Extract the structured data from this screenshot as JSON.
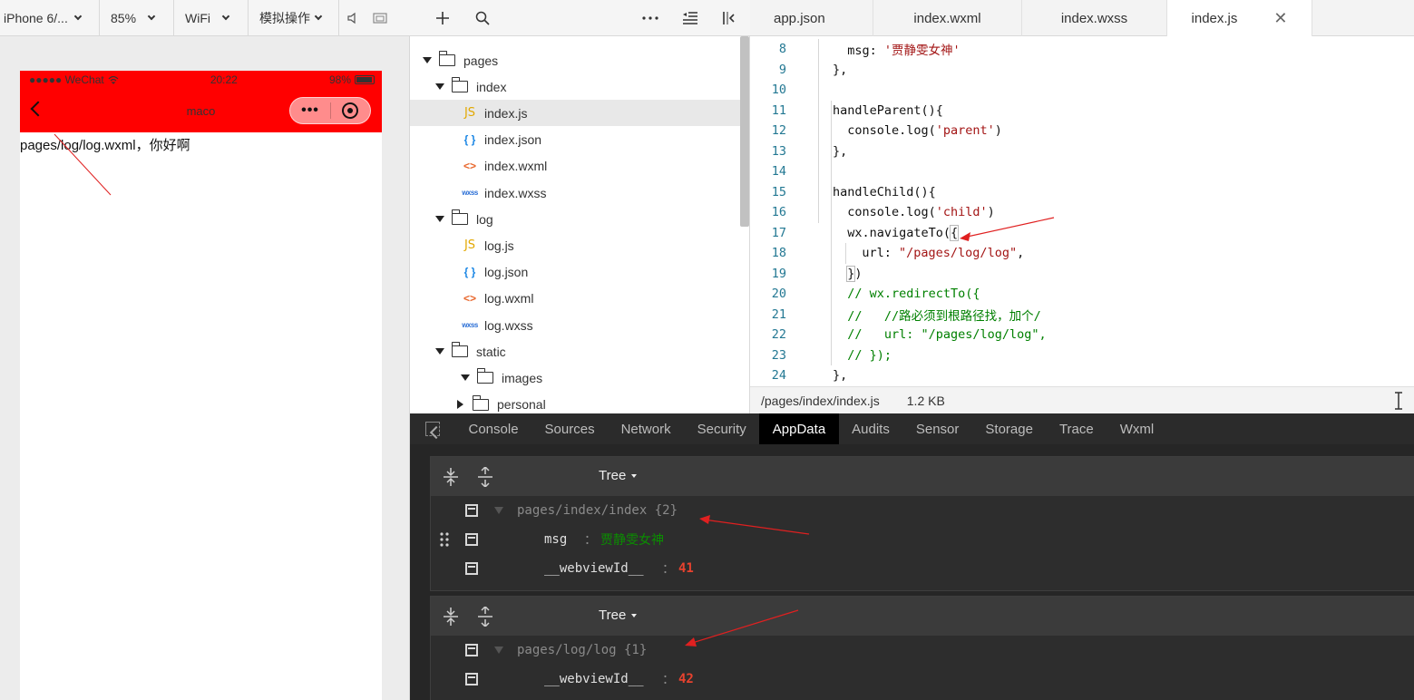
{
  "sim_toolbar": {
    "device": "iPhone 6/...",
    "zoom": "85%",
    "network": "WiFi",
    "mode": "模拟操作"
  },
  "phone": {
    "carrier": "●●●●● WeChat",
    "time": "20:22",
    "battery_pct": "98%",
    "nav_title": "maco",
    "capsule_dots": "•••",
    "page_text": "pages/log/log.wxml，你好啊"
  },
  "file_tree": [
    {
      "label": "pages",
      "type": "folder-open",
      "depth": 0
    },
    {
      "label": "index",
      "type": "folder-open",
      "depth": 1
    },
    {
      "label": "index.js",
      "type": "js",
      "depth": 2,
      "selected": true
    },
    {
      "label": "index.json",
      "type": "json",
      "depth": 2
    },
    {
      "label": "index.wxml",
      "type": "wxml",
      "depth": 2
    },
    {
      "label": "index.wxss",
      "type": "wxss",
      "depth": 2
    },
    {
      "label": "log",
      "type": "folder-open",
      "depth": 1
    },
    {
      "label": "log.js",
      "type": "js",
      "depth": 2
    },
    {
      "label": "log.json",
      "type": "json",
      "depth": 2
    },
    {
      "label": "log.wxml",
      "type": "wxml",
      "depth": 2
    },
    {
      "label": "log.wxss",
      "type": "wxss",
      "depth": 2
    },
    {
      "label": "static",
      "type": "folder-open",
      "depth": 1
    },
    {
      "label": "images",
      "type": "folder-open",
      "depth": 2
    },
    {
      "label": "personal",
      "type": "folder-closed",
      "depth": 3
    }
  ],
  "file_icons": {
    "js": "JS",
    "json": "{ }",
    "wxml": "<>",
    "wxss": "wxss"
  },
  "editor_tabs": [
    "app.json",
    "index.wxml",
    "index.wxss",
    "index.js"
  ],
  "active_tab": "index.js",
  "close_glyph": "✕",
  "code_lines": [
    {
      "n": "8",
      "indent": 1,
      "segs": [
        [
          "msg: ",
          "p"
        ],
        [
          "'贾静雯女神'",
          "s"
        ]
      ]
    },
    {
      "n": "9",
      "indent": 0,
      "segs": [
        [
          "},",
          "p"
        ]
      ]
    },
    {
      "n": "10",
      "indent": 0,
      "segs": []
    },
    {
      "n": "11",
      "indent": 0,
      "segs": [
        [
          "handleParent(){",
          "p"
        ]
      ]
    },
    {
      "n": "12",
      "indent": 1,
      "segs": [
        [
          "console.log(",
          "p"
        ],
        [
          "'parent'",
          "s"
        ],
        [
          ")",
          "p"
        ]
      ]
    },
    {
      "n": "13",
      "indent": 0,
      "segs": [
        [
          "},",
          "p"
        ]
      ]
    },
    {
      "n": "14",
      "indent": 0,
      "segs": []
    },
    {
      "n": "15",
      "indent": 0,
      "segs": [
        [
          "handleChild(){",
          "p"
        ]
      ]
    },
    {
      "n": "16",
      "indent": 1,
      "segs": [
        [
          "console.log(",
          "p"
        ],
        [
          "'child'",
          "s"
        ],
        [
          ")",
          "p"
        ]
      ]
    },
    {
      "n": "17",
      "indent": 1,
      "segs": [
        [
          "wx.navigateTo(",
          "p"
        ],
        [
          "{",
          "b"
        ]
      ]
    },
    {
      "n": "18",
      "indent": 2,
      "segs": [
        [
          "url: ",
          "p"
        ],
        [
          "\"/pages/log/log\"",
          "s"
        ],
        [
          ",",
          "p"
        ]
      ]
    },
    {
      "n": "19",
      "indent": 1,
      "segs": [
        [
          "}",
          "b"
        ],
        [
          ")",
          "p"
        ]
      ]
    },
    {
      "n": "20",
      "indent": 1,
      "segs": [
        [
          "// wx.redirectTo({",
          "c"
        ]
      ]
    },
    {
      "n": "21",
      "indent": 1,
      "segs": [
        [
          "//   //路必须到根路径找，加个/",
          "c"
        ]
      ]
    },
    {
      "n": "22",
      "indent": 1,
      "segs": [
        [
          "//   url: \"/pages/log/log\",",
          "c"
        ]
      ]
    },
    {
      "n": "23",
      "indent": 1,
      "segs": [
        [
          "// });",
          "c"
        ]
      ]
    },
    {
      "n": "24",
      "indent": 0,
      "segs": [
        [
          "},",
          "p"
        ]
      ]
    }
  ],
  "editor_status": {
    "path": "/pages/index/index.js",
    "size": "1.2 KB"
  },
  "devtools_tabs": [
    "Console",
    "Sources",
    "Network",
    "Security",
    "AppData",
    "Audits",
    "Sensor",
    "Storage",
    "Trace",
    "Wxml"
  ],
  "active_devtools_tab": "AppData",
  "appdata_panels": [
    {
      "view_mode": "Tree",
      "path": "pages/index/index {2}",
      "entries": [
        {
          "key": "msg",
          "value": "贾静雯女神",
          "kind": "string"
        },
        {
          "key": "__webviewId__",
          "value": "41",
          "kind": "number"
        }
      ]
    },
    {
      "view_mode": "Tree",
      "path": "pages/log/log {1}",
      "entries": [
        {
          "key": "__webviewId__",
          "value": "42",
          "kind": "number"
        }
      ]
    }
  ],
  "colors": {
    "navbar_red": "#ff0000",
    "annotation_red": "#e02020",
    "string_green": "#0a8f00",
    "number_red": "#e8422e"
  },
  "icons": {
    "volume": "speaker-icon",
    "window": "window-icon",
    "add": "plus-icon",
    "search": "search-icon",
    "more": "more-icon",
    "outdent": "outdent-icon",
    "collapse": "collapse-sidebar-icon",
    "expand_all": "expand-all-icon",
    "collapse_all": "collapse-all-icon",
    "inspect": "inspect-icon",
    "text_cursor": "text-cursor-icon"
  }
}
